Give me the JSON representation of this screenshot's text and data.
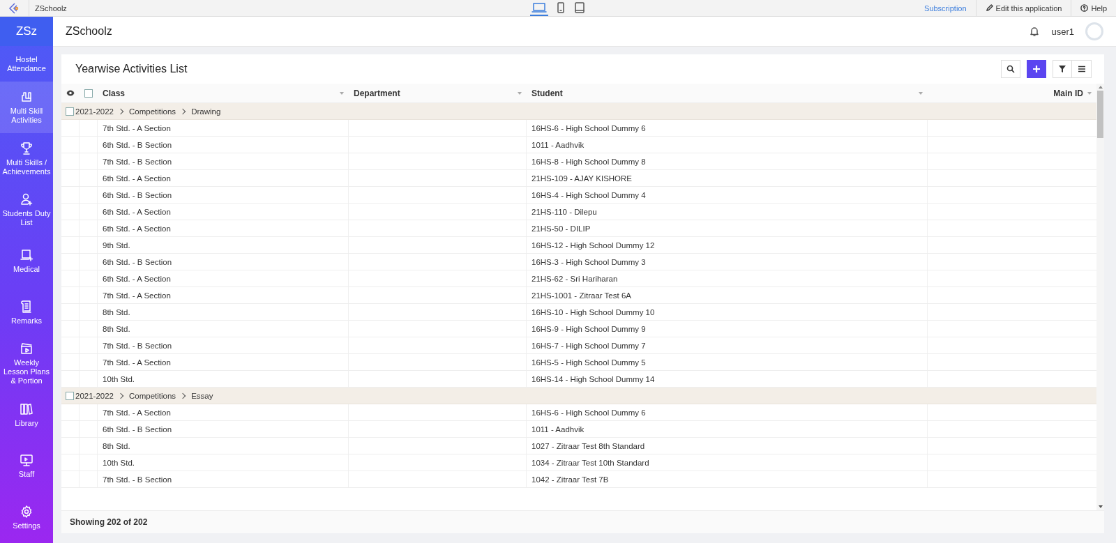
{
  "topbar": {
    "app_name": "ZSchoolz",
    "devices": [
      {
        "kind": "desktop",
        "selected": true
      },
      {
        "kind": "phone",
        "selected": false
      },
      {
        "kind": "tablet",
        "selected": false
      }
    ],
    "links": [
      {
        "kind": "subscription",
        "label": "Subscription"
      },
      {
        "kind": "edit",
        "label": "Edit this application"
      },
      {
        "kind": "help",
        "label": "Help"
      }
    ]
  },
  "sidebar": {
    "logo": "ZSz",
    "items": [
      {
        "label": "Hostel Attendance",
        "selected": false
      },
      {
        "label": "Multi Skill Activities",
        "selected": true
      },
      {
        "label": "Multi Skills / Achievements",
        "selected": false
      },
      {
        "label": "Students Duty List",
        "selected": false
      },
      {
        "label": "Medical",
        "selected": false
      },
      {
        "label": "Remarks",
        "selected": false
      },
      {
        "label": "Weekly Lesson Plans & Portion",
        "selected": false
      },
      {
        "label": "Library",
        "selected": false
      },
      {
        "label": "Staff",
        "selected": false
      },
      {
        "label": "Settings",
        "selected": false
      }
    ]
  },
  "header": {
    "title": "ZSchoolz",
    "user": "user1"
  },
  "report": {
    "title": "Yearwise Activities List",
    "columns": [
      "Class",
      "Department",
      "Student",
      "Main ID"
    ],
    "select_all_checked": false,
    "groups": [
      {
        "path": [
          "2021-2022",
          "Competitions",
          "Drawing"
        ],
        "checked": false,
        "rows": [
          [
            "7th Std. - A Section",
            "",
            "16HS-6 - High School Dummy 6",
            ""
          ],
          [
            "6th Std. - B Section",
            "",
            "1011 - Aadhvik",
            ""
          ],
          [
            "7th Std. - B Section",
            "",
            "16HS-8 - High School Dummy 8",
            ""
          ],
          [
            "6th Std. - A Section",
            "",
            "21HS-109 - AJAY KISHORE",
            ""
          ],
          [
            "6th Std. - B Section",
            "",
            "16HS-4 - High School Dummy 4",
            ""
          ],
          [
            "6th Std. - A Section",
            "",
            "21HS-110 - Dilepu",
            ""
          ],
          [
            "6th Std. - A Section",
            "",
            "21HS-50 - DILIP",
            ""
          ],
          [
            "9th Std.",
            "",
            "16HS-12 - High School Dummy 12",
            ""
          ],
          [
            "6th Std. - B Section",
            "",
            "16HS-3 - High School Dummy 3",
            ""
          ],
          [
            "6th Std. - A Section",
            "",
            "21HS-62 - Sri Hariharan",
            ""
          ],
          [
            "7th Std. - A Section",
            "",
            "21HS-1001 - Zitraar Test 6A",
            ""
          ],
          [
            "8th Std.",
            "",
            "16HS-10 - High School Dummy 10",
            ""
          ],
          [
            "8th Std.",
            "",
            "16HS-9 - High School Dummy 9",
            ""
          ],
          [
            "7th Std. - B Section",
            "",
            "16HS-7 - High School Dummy 7",
            ""
          ],
          [
            "7th Std. - A Section",
            "",
            "16HS-5 - High School Dummy 5",
            ""
          ],
          [
            "10th Std.",
            "",
            "16HS-14 - High School Dummy 14",
            ""
          ]
        ]
      },
      {
        "path": [
          "2021-2022",
          "Competitions",
          "Essay"
        ],
        "checked": false,
        "rows": [
          [
            "7th Std. - A Section",
            "",
            "16HS-6 - High School Dummy 6",
            ""
          ],
          [
            "6th Std. - B Section",
            "",
            "1011 - Aadhvik",
            ""
          ],
          [
            "8th Std.",
            "",
            "1027 - Zitraar Test 8th Standard",
            ""
          ],
          [
            "10th Std.",
            "",
            "1034 - Zitraar Test 10th Standard",
            ""
          ],
          [
            "7th Std. - B Section",
            "",
            "1042 - Zitraar Test 7B",
            ""
          ]
        ]
      }
    ],
    "footer": "Showing 202 of 202"
  }
}
